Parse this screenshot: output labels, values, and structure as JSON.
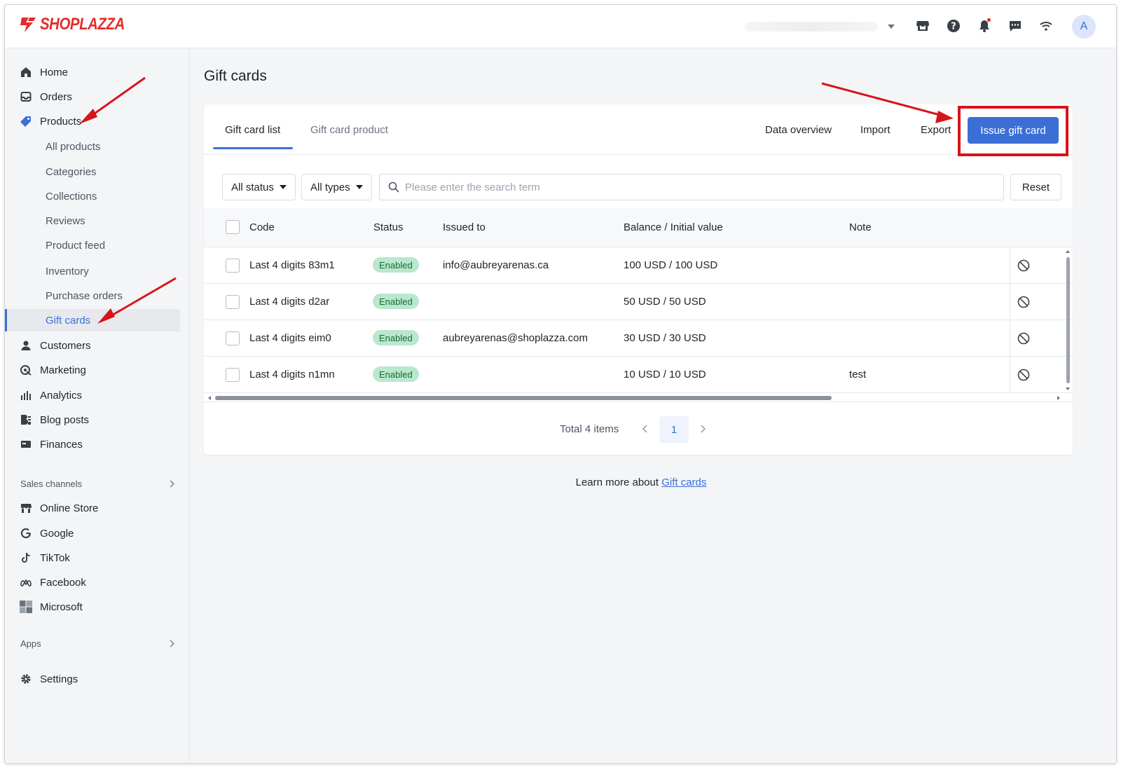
{
  "brand": {
    "name": "SHOPLAZZA",
    "color": "#e52b2b"
  },
  "header": {
    "icons": [
      "storefront-icon",
      "help-icon",
      "bell-icon",
      "message-icon",
      "wifi-icon"
    ],
    "avatar_initial": "A"
  },
  "sidebar": {
    "items": [
      {
        "label": "Home",
        "icon": "home-icon"
      },
      {
        "label": "Orders",
        "icon": "orders-icon"
      },
      {
        "label": "Products",
        "icon": "tag-icon"
      }
    ],
    "product_subitems": [
      {
        "label": "All products"
      },
      {
        "label": "Categories"
      },
      {
        "label": "Collections"
      },
      {
        "label": "Reviews"
      },
      {
        "label": "Product feed"
      },
      {
        "label": "Inventory"
      },
      {
        "label": "Purchase orders"
      },
      {
        "label": "Gift cards",
        "active": true
      }
    ],
    "items_after": [
      {
        "label": "Customers",
        "icon": "person-icon"
      },
      {
        "label": "Marketing",
        "icon": "marketing-icon"
      },
      {
        "label": "Analytics",
        "icon": "analytics-icon"
      },
      {
        "label": "Blog posts",
        "icon": "blog-icon"
      },
      {
        "label": "Finances",
        "icon": "finances-icon"
      }
    ],
    "sales_channels_label": "Sales channels",
    "channels": [
      {
        "label": "Online Store",
        "icon": "storefront-icon"
      },
      {
        "label": "Google",
        "icon": "google-icon"
      },
      {
        "label": "TikTok",
        "icon": "tiktok-icon"
      },
      {
        "label": "Facebook",
        "icon": "meta-icon"
      },
      {
        "label": "Microsoft",
        "icon": "microsoft-icon"
      }
    ],
    "apps_label": "Apps",
    "settings_label": "Settings"
  },
  "main": {
    "title": "Gift cards",
    "tabs": [
      {
        "label": "Gift card list",
        "active": true
      },
      {
        "label": "Gift card product",
        "active": false
      }
    ],
    "actions": {
      "data_overview": "Data overview",
      "import": "Import",
      "export": "Export",
      "issue": "Issue gift card"
    },
    "filters": {
      "status": "All status",
      "types": "All types",
      "search_placeholder": "Please enter the search term",
      "reset": "Reset"
    },
    "columns": {
      "code": "Code",
      "status": "Status",
      "issued_to": "Issued to",
      "balance": "Balance / Initial value",
      "note": "Note"
    },
    "rows": [
      {
        "code": "Last 4 digits 83m1",
        "status": "Enabled",
        "issued_to": "info@aubreyarenas.ca",
        "balance": "100 USD / 100 USD",
        "note": ""
      },
      {
        "code": "Last 4 digits d2ar",
        "status": "Enabled",
        "issued_to": "",
        "balance": "50 USD / 50 USD",
        "note": ""
      },
      {
        "code": "Last 4 digits eim0",
        "status": "Enabled",
        "issued_to": "aubreyarenas@shoplazza.com",
        "balance": "30 USD / 30 USD",
        "note": ""
      },
      {
        "code": "Last 4 digits n1mn",
        "status": "Enabled",
        "issued_to": "",
        "balance": "10 USD / 10 USD",
        "note": "test"
      }
    ],
    "pagination": {
      "total": "Total 4 items",
      "page": "1"
    },
    "learn_more": {
      "prefix": "Learn more about ",
      "link": "Gift cards"
    }
  },
  "colors": {
    "accent": "#3b6fd6",
    "annotation": "#d8141b",
    "enabled_badge": "#b9e8cc"
  }
}
